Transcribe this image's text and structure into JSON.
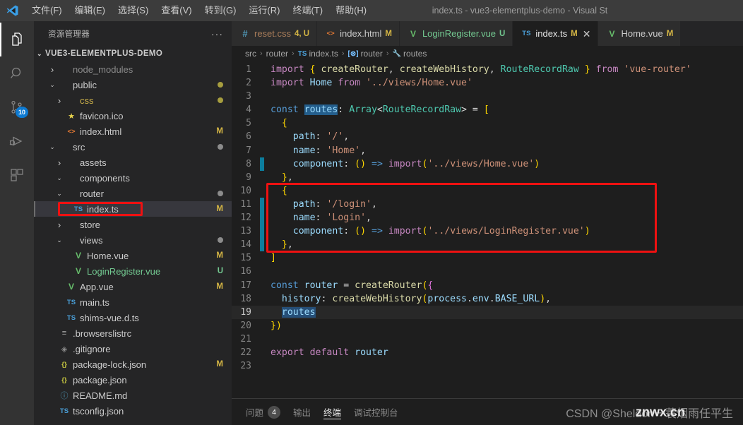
{
  "window": {
    "title": "index.ts - vue3-elementplus-demo - Visual St",
    "logo_icon": "vscode-logo-icon"
  },
  "menubar": {
    "items": [
      {
        "label": "文件(F)",
        "name": "menu-file"
      },
      {
        "label": "编辑(E)",
        "name": "menu-edit"
      },
      {
        "label": "选择(S)",
        "name": "menu-selection"
      },
      {
        "label": "查看(V)",
        "name": "menu-view"
      },
      {
        "label": "转到(G)",
        "name": "menu-goto"
      },
      {
        "label": "运行(R)",
        "name": "menu-run"
      },
      {
        "label": "终端(T)",
        "name": "menu-terminal"
      },
      {
        "label": "帮助(H)",
        "name": "menu-help"
      }
    ]
  },
  "activitybar": {
    "items": [
      {
        "icon": "explorer-icon",
        "active": true,
        "badge": ""
      },
      {
        "icon": "search-icon",
        "active": false,
        "badge": ""
      },
      {
        "icon": "source-control-icon",
        "active": false,
        "badge": "10"
      },
      {
        "icon": "run-debug-icon",
        "active": false,
        "badge": ""
      },
      {
        "icon": "extensions-icon",
        "active": false,
        "badge": ""
      }
    ]
  },
  "sidebar": {
    "header": "资源管理器",
    "more_label": "···",
    "root": "VUE3-ELEMENTPLUS-DEMO",
    "tree": [
      {
        "label": "node_modules",
        "indent": 1,
        "twisty": "collapsed",
        "icon": "",
        "iconColor": "",
        "textColor": "#8c8c8c",
        "status": "",
        "statusColor": "",
        "dot": ""
      },
      {
        "label": "public",
        "indent": 1,
        "twisty": "expanded",
        "icon": "",
        "iconColor": "",
        "textColor": "#cccccc",
        "status": "",
        "statusColor": "",
        "dot": "#a79e3f"
      },
      {
        "label": "css",
        "indent": 2,
        "twisty": "collapsed",
        "icon": "",
        "iconColor": "",
        "textColor": "#cbb04a",
        "status": "",
        "statusColor": "",
        "dot": "#a79e3f"
      },
      {
        "label": "favicon.ico",
        "indent": 2,
        "twisty": "none",
        "icon": "★",
        "iconColor": "#e8d44d",
        "textColor": "#cccccc",
        "status": "",
        "statusColor": "",
        "dot": ""
      },
      {
        "label": "index.html",
        "indent": 2,
        "twisty": "none",
        "icon": "<>",
        "iconColor": "#e37933",
        "textColor": "#cccccc",
        "status": "M",
        "statusColor": "#d4b544",
        "dot": ""
      },
      {
        "label": "src",
        "indent": 1,
        "twisty": "expanded",
        "icon": "",
        "iconColor": "",
        "textColor": "#cccccc",
        "status": "",
        "statusColor": "",
        "dot": "#8c8c8c"
      },
      {
        "label": "assets",
        "indent": 2,
        "twisty": "collapsed",
        "icon": "",
        "iconColor": "",
        "textColor": "#cccccc",
        "status": "",
        "statusColor": "",
        "dot": ""
      },
      {
        "label": "components",
        "indent": 2,
        "twisty": "expanded",
        "icon": "",
        "iconColor": "",
        "textColor": "#cccccc",
        "status": "",
        "statusColor": "",
        "dot": ""
      },
      {
        "label": "router",
        "indent": 2,
        "twisty": "expanded",
        "icon": "",
        "iconColor": "",
        "textColor": "#cccccc",
        "status": "",
        "statusColor": "",
        "dot": "#8c8c8c"
      },
      {
        "label": "index.ts",
        "indent": 3,
        "twisty": "none",
        "icon": "TS",
        "iconColor": "#4a9fd8",
        "textColor": "#cccccc",
        "status": "M",
        "statusColor": "#d4b544",
        "dot": "",
        "selected": true,
        "annotated": true
      },
      {
        "label": "store",
        "indent": 2,
        "twisty": "collapsed",
        "icon": "",
        "iconColor": "",
        "textColor": "#cccccc",
        "status": "",
        "statusColor": "",
        "dot": ""
      },
      {
        "label": "views",
        "indent": 2,
        "twisty": "expanded",
        "icon": "",
        "iconColor": "",
        "textColor": "#cccccc",
        "status": "",
        "statusColor": "",
        "dot": "#8c8c8c"
      },
      {
        "label": "Home.vue",
        "indent": 3,
        "twisty": "none",
        "icon": "V",
        "iconColor": "#66bb6a",
        "textColor": "#cccccc",
        "status": "M",
        "statusColor": "#d4b544",
        "dot": ""
      },
      {
        "label": "LoginRegister.vue",
        "indent": 3,
        "twisty": "none",
        "icon": "V",
        "iconColor": "#66bb6a",
        "textColor": "#73c991",
        "status": "U",
        "statusColor": "#73c991",
        "dot": ""
      },
      {
        "label": "App.vue",
        "indent": 2,
        "twisty": "none",
        "icon": "V",
        "iconColor": "#66bb6a",
        "textColor": "#cccccc",
        "status": "M",
        "statusColor": "#d4b544",
        "dot": ""
      },
      {
        "label": "main.ts",
        "indent": 2,
        "twisty": "none",
        "icon": "TS",
        "iconColor": "#4a9fd8",
        "textColor": "#cccccc",
        "status": "",
        "statusColor": "",
        "dot": ""
      },
      {
        "label": "shims-vue.d.ts",
        "indent": 2,
        "twisty": "none",
        "icon": "TS",
        "iconColor": "#4a9fd8",
        "textColor": "#cccccc",
        "status": "",
        "statusColor": "",
        "dot": ""
      },
      {
        "label": ".browserslistrc",
        "indent": 1,
        "twisty": "none",
        "icon": "≡",
        "iconColor": "#a0a0a0",
        "textColor": "#cccccc",
        "status": "",
        "statusColor": "",
        "dot": ""
      },
      {
        "label": ".gitignore",
        "indent": 1,
        "twisty": "none",
        "icon": "◈",
        "iconColor": "#8c8c8c",
        "textColor": "#cccccc",
        "status": "",
        "statusColor": "",
        "dot": ""
      },
      {
        "label": "package-lock.json",
        "indent": 1,
        "twisty": "none",
        "icon": "{}",
        "iconColor": "#cbcb41",
        "textColor": "#cccccc",
        "status": "M",
        "statusColor": "#d4b544",
        "dot": ""
      },
      {
        "label": "package.json",
        "indent": 1,
        "twisty": "none",
        "icon": "{}",
        "iconColor": "#cbcb41",
        "textColor": "#cccccc",
        "status": "",
        "statusColor": "",
        "dot": ""
      },
      {
        "label": "README.md",
        "indent": 1,
        "twisty": "none",
        "icon": "ⓘ",
        "iconColor": "#519aba",
        "textColor": "#cccccc",
        "status": "",
        "statusColor": "",
        "dot": ""
      },
      {
        "label": "tsconfig.json",
        "indent": 1,
        "twisty": "none",
        "icon": "TS",
        "iconColor": "#4a9fd8",
        "textColor": "#cccccc",
        "status": "",
        "statusColor": "",
        "dot": ""
      }
    ]
  },
  "tabs": [
    {
      "label": "reset.css",
      "icon": "#",
      "iconColor": "#519aba",
      "textColor": "#a97d5a",
      "badge": "4, U",
      "badgeColor": "#d4b544",
      "active": false,
      "close": false
    },
    {
      "label": "index.html",
      "icon": "<>",
      "iconColor": "#e37933",
      "textColor": "#c9c9c9",
      "badge": "M",
      "badgeColor": "#d4b544",
      "active": false,
      "close": false
    },
    {
      "label": "LoginRegister.vue",
      "icon": "V",
      "iconColor": "#66bb6a",
      "textColor": "#73c991",
      "badge": "U",
      "badgeColor": "#73c991",
      "active": false,
      "close": false
    },
    {
      "label": "index.ts",
      "icon": "TS",
      "iconColor": "#4a9fd8",
      "textColor": "#e8e8e8",
      "badge": "M",
      "badgeColor": "#d4b544",
      "active": true,
      "close": true,
      "close_icon": "close-icon"
    },
    {
      "label": "Home.vue",
      "icon": "V",
      "iconColor": "#66bb6a",
      "textColor": "#cccccc",
      "badge": "M",
      "badgeColor": "#d4b544",
      "active": false,
      "close": false
    }
  ],
  "breadcrumb": [
    {
      "label": "src",
      "icon": "",
      "iconColor": ""
    },
    {
      "label": "router",
      "icon": "",
      "iconColor": ""
    },
    {
      "label": "index.ts",
      "icon": "TS",
      "iconColor": "#4a9fd8"
    },
    {
      "label": "router",
      "icon": "[⊗]",
      "iconColor": "#75beff"
    },
    {
      "label": "routes",
      "icon": "🔧",
      "iconColor": "#c5c5c5"
    }
  ],
  "editor": {
    "language": "typescript",
    "current_line": 19,
    "selected_word": "routes",
    "modified_lines": [
      8,
      11,
      12,
      13,
      14
    ],
    "lines": [
      {
        "n": 1,
        "text": "import { createRouter, createWebHistory, RouteRecordRaw } from 'vue-router'"
      },
      {
        "n": 2,
        "text": "import Home from '../views/Home.vue'"
      },
      {
        "n": 3,
        "text": ""
      },
      {
        "n": 4,
        "text": "const routes: Array<RouteRecordRaw> = ["
      },
      {
        "n": 5,
        "text": "  {"
      },
      {
        "n": 6,
        "text": "    path: '/',"
      },
      {
        "n": 7,
        "text": "    name: 'Home',"
      },
      {
        "n": 8,
        "text": "    component: () => import('../views/Home.vue')"
      },
      {
        "n": 9,
        "text": "  },"
      },
      {
        "n": 10,
        "text": "  {"
      },
      {
        "n": 11,
        "text": "    path: '/login',"
      },
      {
        "n": 12,
        "text": "    name: 'Login',"
      },
      {
        "n": 13,
        "text": "    component: () => import('../views/LoginRegister.vue')"
      },
      {
        "n": 14,
        "text": "  },"
      },
      {
        "n": 15,
        "text": "]"
      },
      {
        "n": 16,
        "text": ""
      },
      {
        "n": 17,
        "text": "const router = createRouter({"
      },
      {
        "n": 18,
        "text": "  history: createWebHistory(process.env.BASE_URL),"
      },
      {
        "n": 19,
        "text": "  routes"
      },
      {
        "n": 20,
        "text": "})"
      },
      {
        "n": 21,
        "text": ""
      },
      {
        "n": 22,
        "text": "export default router"
      },
      {
        "n": 23,
        "text": ""
      }
    ],
    "annotation": {
      "color": "#ee1111",
      "covers_lines": "10-14"
    }
  },
  "panel": {
    "tabs": [
      {
        "label": "问题",
        "count": "4",
        "active": false
      },
      {
        "label": "输出",
        "count": "",
        "active": false
      },
      {
        "label": "终端",
        "count": "",
        "active": true
      },
      {
        "label": "调试控制台",
        "count": "",
        "active": false
      }
    ]
  },
  "watermark": {
    "text": "CSDN @Sheldon一蓑烟雨任平生",
    "overlay": "znwx.cn"
  }
}
